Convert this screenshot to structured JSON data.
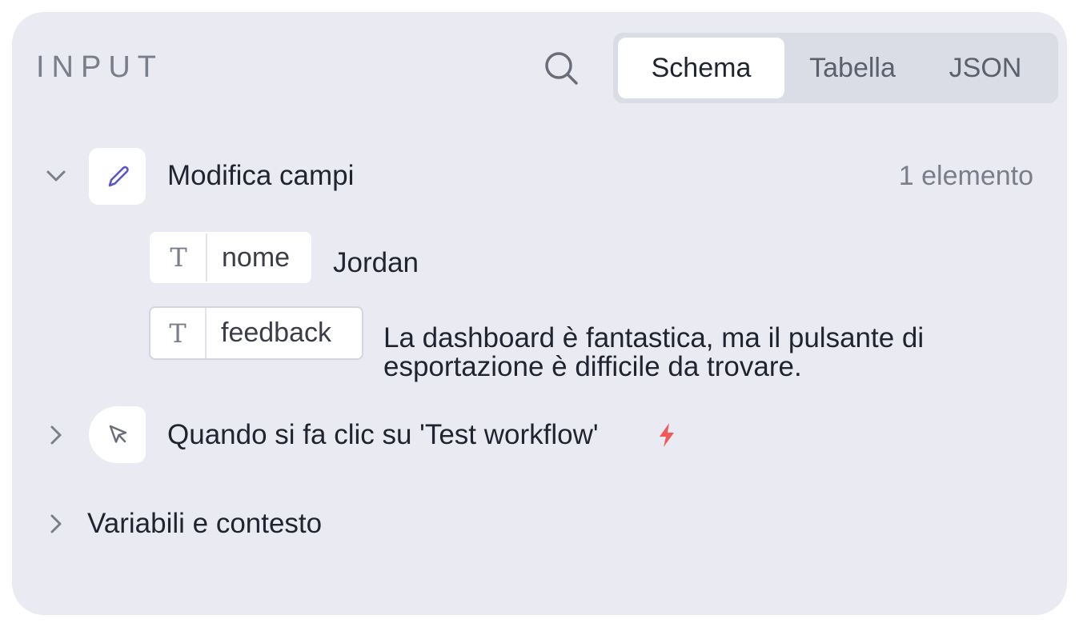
{
  "header": {
    "title": "INPUT",
    "search_icon": "search-icon",
    "tabs": [
      {
        "label": "Schema",
        "active": true
      },
      {
        "label": "Tabella",
        "active": false
      },
      {
        "label": "JSON",
        "active": false
      }
    ]
  },
  "groups": [
    {
      "label": "Modifica campi",
      "icon": "pencil-icon",
      "expanded": true,
      "count": "1 elemento",
      "fields": [
        {
          "type_icon": "T",
          "name": "nome",
          "value": "Jordan"
        },
        {
          "type_icon": "T",
          "name": "feedback",
          "value_lines": [
            "La dashboard è fantastica, ma il pulsante di",
            "esportazione è difficile da trovare."
          ]
        }
      ]
    },
    {
      "label": "Quando si fa clic su 'Test workflow'",
      "icon": "cursor-click-icon",
      "badge_icon": "lightning-icon",
      "expanded": false
    },
    {
      "label": "Variabili e contesto",
      "expanded": false
    }
  ],
  "colors": {
    "panel_bg": "#e9eaf2",
    "accent_pencil": "#5a55c8",
    "lightning": "#f05a5a"
  }
}
